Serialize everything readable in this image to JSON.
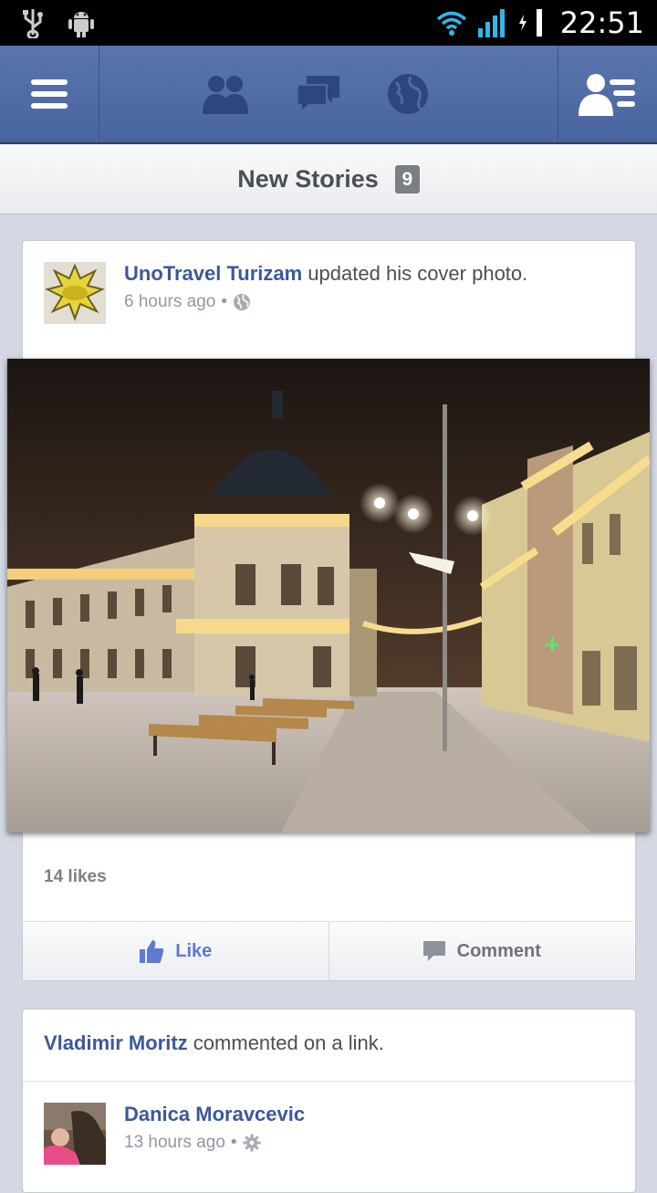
{
  "status_bar": {
    "time": "22:51"
  },
  "navbar": {
    "icons": [
      "menu-icon",
      "friend-requests-icon",
      "messages-icon",
      "notifications-globe-icon",
      "friends-list-icon"
    ]
  },
  "new_stories": {
    "label": "New Stories",
    "count": "9"
  },
  "post1": {
    "author": "UnoTravel Turizam",
    "action_text": " updated his cover photo.",
    "time": "6 hours ago",
    "separator": "•",
    "privacy_icon": "globe-icon",
    "likes": "14 likes",
    "like_label": "Like",
    "comment_label": "Comment"
  },
  "post2": {
    "actor": "Vladimir Moritz",
    "action_text": " commented on a link.",
    "author": "Danica Moravcevic",
    "time": "13 hours ago",
    "separator": "•",
    "privacy_icon": "gear-icon"
  },
  "colors": {
    "brand_blue": "#3b5998",
    "navbar": "#4e68a4",
    "like_blue": "#5b7bd5"
  }
}
